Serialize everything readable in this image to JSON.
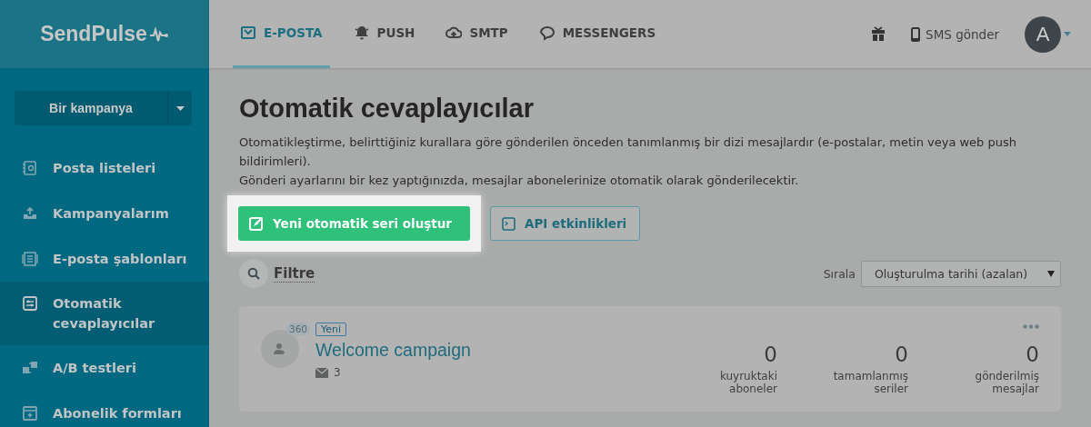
{
  "logo": {
    "text": "SendPulse"
  },
  "top_tabs": [
    {
      "label": "E-POSTA",
      "selected": true
    },
    {
      "label": "PUSH",
      "selected": false
    },
    {
      "label": "SMTP",
      "selected": false
    },
    {
      "label": "MESSENGERS",
      "selected": false
    }
  ],
  "header_right": {
    "sms_label": "SMS gönder",
    "avatar": "A"
  },
  "sidebar": {
    "create_button": "Bir kampanya",
    "items": [
      {
        "label": "Posta listeleri",
        "selected": false
      },
      {
        "label": "Kampanyalarım",
        "selected": false
      },
      {
        "label": "E-posta şablonları",
        "selected": false
      },
      {
        "label": "Otomatik cevaplayıcılar",
        "selected": true
      },
      {
        "label": "A/B testleri",
        "selected": false
      },
      {
        "label": "Abonelik formları",
        "selected": false
      }
    ]
  },
  "page": {
    "title": "Otomatik cevaplayıcılar",
    "description": [
      "Otomatikleştirme, belirttiğiniz kurallara göre gönderilen önceden tanımlanmış bir dizi mesajlardır (e-postalar, metin veya web push bildirimleri).",
      "Gönderi ayarlarını bir kez yaptığınızda, mesajlar abonelerinize otomatik olarak gönderilecektir."
    ],
    "primary_button": "Yeni otomatik seri oluştur",
    "secondary_button": "API etkinlikleri",
    "filter_label": "Filtre",
    "sort_label": "Sırala",
    "sort_value": "Oluşturulma tarihi (azalan)"
  },
  "campaigns": [
    {
      "badge": "Yeni",
      "count": "360",
      "name": "Welcome campaign",
      "emails": "3",
      "stats": [
        {
          "value": "0",
          "label": "kuyruktaki aboneler"
        },
        {
          "value": "0",
          "label": "tamamlanmış seriler"
        },
        {
          "value": "0",
          "label": "gönderilmiş mesajlar"
        }
      ]
    }
  ]
}
